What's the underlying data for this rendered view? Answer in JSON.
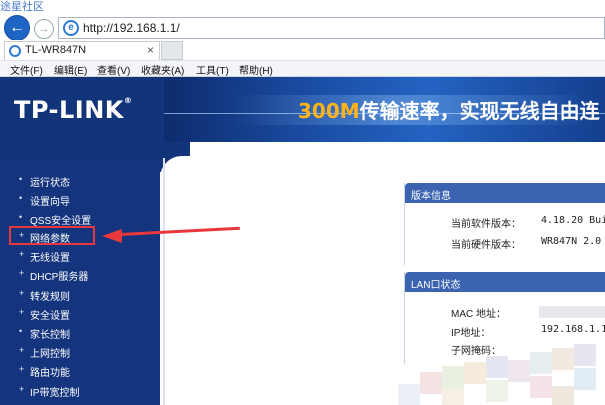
{
  "watermark": "途星社区",
  "browser": {
    "url": "http://192.168.1.1/",
    "tab_title": "TL-WR847N",
    "tab_close": "×",
    "menu": [
      "文件(F)",
      "编辑(E)",
      "查看(V)",
      "收藏夹(A)",
      "工具(T)",
      "帮助(H)"
    ]
  },
  "header": {
    "logo": "TP-LINK",
    "logo_mark": "®",
    "banner_accent": "300M",
    "banner_text": "传输速率，实现无线自由连"
  },
  "sidebar": {
    "items": [
      {
        "label": "运行状态"
      },
      {
        "label": "设置向导"
      },
      {
        "label": "QSS安全设置"
      },
      {
        "label": "网络参数"
      },
      {
        "label": "无线设置"
      },
      {
        "label": "DHCP服务器"
      },
      {
        "label": "转发规则"
      },
      {
        "label": "安全设置"
      },
      {
        "label": "家长控制"
      },
      {
        "label": "上网控制"
      },
      {
        "label": "路由功能"
      },
      {
        "label": "IP带宽控制"
      }
    ],
    "highlighted": "网络参数"
  },
  "version_panel": {
    "title": "版本信息",
    "software_label": "当前软件版本：",
    "software_value": "4.18.20 Buil",
    "hardware_label": "当前硬件版本：",
    "hardware_value": "WR847N 2.0 ("
  },
  "lan_panel": {
    "title": "LAN口状态",
    "mac_label": "MAC 地址：",
    "ip_label": "IP地址：",
    "ip_value": "192.168.1.1",
    "mask_label": "子网掩码："
  },
  "colors": {
    "header_bg": "#12347a",
    "panel_head": "#3b63b0",
    "highlight": "#e8383d",
    "banner_accent": "#ffb31a"
  }
}
